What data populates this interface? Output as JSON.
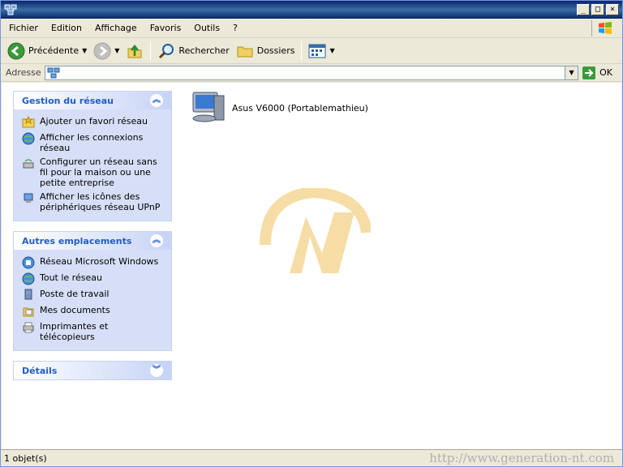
{
  "window": {
    "title": "",
    "controls": [
      "_",
      "□",
      "×"
    ]
  },
  "menu": [
    "Fichier",
    "Edition",
    "Affichage",
    "Favoris",
    "Outils",
    "?"
  ],
  "toolbar": {
    "back_label": "Précédente",
    "search_label": "Rechercher",
    "folders_label": "Dossiers"
  },
  "address": {
    "label": "Adresse",
    "value": "",
    "go_label": "OK"
  },
  "tasks": {
    "network": {
      "title": "Gestion du réseau",
      "items": [
        {
          "label": "Ajouter un favori réseau",
          "icon": "add-favorite-icon"
        },
        {
          "label": "Afficher les connexions réseau",
          "icon": "globe-icon"
        },
        {
          "label": "Configurer un réseau sans fil pour la maison ou une petite entreprise",
          "icon": "wireless-icon"
        },
        {
          "label": "Afficher les icônes des périphériques réseau UPnP",
          "icon": "upnp-icon"
        }
      ]
    },
    "other": {
      "title": "Autres emplacements",
      "items": [
        {
          "label": "Réseau Microsoft Windows",
          "icon": "network-icon"
        },
        {
          "label": "Tout le réseau",
          "icon": "globe-icon"
        },
        {
          "label": "Poste de travail",
          "icon": "computer-icon"
        },
        {
          "label": "Mes documents",
          "icon": "documents-icon"
        },
        {
          "label": "Imprimantes et télécopieurs",
          "icon": "printer-icon"
        }
      ]
    },
    "details": {
      "title": "Détails"
    }
  },
  "files": [
    {
      "label": "Asus V6000 (Portablemathieu)",
      "icon": "computer-icon"
    }
  ],
  "status": {
    "count": "1 objet(s)",
    "watermark": "http://www.generation-nt.com"
  }
}
